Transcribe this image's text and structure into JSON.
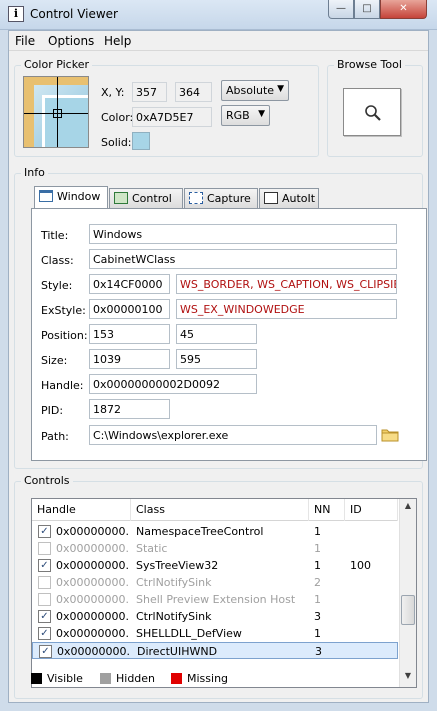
{
  "window": {
    "title": "Control Viewer",
    "app_icon_glyph": "i",
    "min_glyph": "—",
    "max_glyph": "□",
    "close_glyph": "✕"
  },
  "menu": [
    "File",
    "Options",
    "Help"
  ],
  "color_picker": {
    "title": "Color Picker",
    "xy_label": "X, Y:",
    "x": "357",
    "y": "364",
    "coord_mode": "Absolute",
    "color_label": "Color:",
    "color_value": "0xA7D5E7",
    "color_format": "RGB",
    "solid_label": "Solid:",
    "solid_color": "#a7d5e7"
  },
  "browse_tool": {
    "title": "Browse Tool",
    "icon": "magnifier-icon"
  },
  "info": {
    "title": "Info",
    "tabs": [
      {
        "label": "Window",
        "icon": "window-icon"
      },
      {
        "label": "Control",
        "icon": "control-icon"
      },
      {
        "label": "Capture",
        "icon": "capture-icon"
      },
      {
        "label": "AutoIt",
        "icon": "autoit-icon"
      }
    ],
    "fields": {
      "title_label": "Title:",
      "title": "Windows",
      "class_label": "Class:",
      "class": "CabinetWClass",
      "style_label": "Style:",
      "style": "0x14CF0000",
      "style_flags": "WS_BORDER, WS_CAPTION, WS_CLIPSIE",
      "exstyle_label": "ExStyle:",
      "exstyle": "0x00000100",
      "exstyle_flags": "WS_EX_WINDOWEDGE",
      "position_label": "Position:",
      "pos_x": "153",
      "pos_y": "45",
      "size_label": "Size:",
      "width": "1039",
      "height": "595",
      "handle_label": "Handle:",
      "handle": "0x00000000002D0092",
      "pid_label": "PID:",
      "pid": "1872",
      "path_label": "Path:",
      "path": "C:\\Windows\\explorer.exe"
    }
  },
  "controls": {
    "title": "Controls",
    "columns": [
      "Handle",
      "Class",
      "NN",
      "ID"
    ],
    "rows": [
      {
        "checked": true,
        "state": "visible",
        "handle": "0x00000000...",
        "class": "NamespaceTreeControl",
        "nn": "1",
        "id": ""
      },
      {
        "checked": false,
        "state": "hidden",
        "handle": "0x00000000...",
        "class": "Static",
        "nn": "1",
        "id": ""
      },
      {
        "checked": true,
        "state": "visible",
        "handle": "0x00000000...",
        "class": "SysTreeView32",
        "nn": "1",
        "id": "100"
      },
      {
        "checked": false,
        "state": "hidden",
        "handle": "0x00000000...",
        "class": "CtrlNotifySink",
        "nn": "2",
        "id": ""
      },
      {
        "checked": false,
        "state": "hidden",
        "handle": "0x00000000...",
        "class": "Shell Preview Extension Host",
        "nn": "1",
        "id": ""
      },
      {
        "checked": true,
        "state": "visible",
        "handle": "0x00000000...",
        "class": "CtrlNotifySink",
        "nn": "3",
        "id": ""
      },
      {
        "checked": true,
        "state": "visible",
        "handle": "0x00000000...",
        "class": "SHELLDLL_DefView",
        "nn": "1",
        "id": ""
      },
      {
        "checked": true,
        "state": "visible",
        "handle": "0x00000000...",
        "class": "DirectUIHWND",
        "nn": "3",
        "id": "",
        "selected": true
      }
    ],
    "legend": [
      {
        "label": "Visible",
        "color": "#000000"
      },
      {
        "label": "Hidden",
        "color": "#a0a0a0"
      },
      {
        "label": "Missing",
        "color": "#e00000"
      }
    ]
  }
}
